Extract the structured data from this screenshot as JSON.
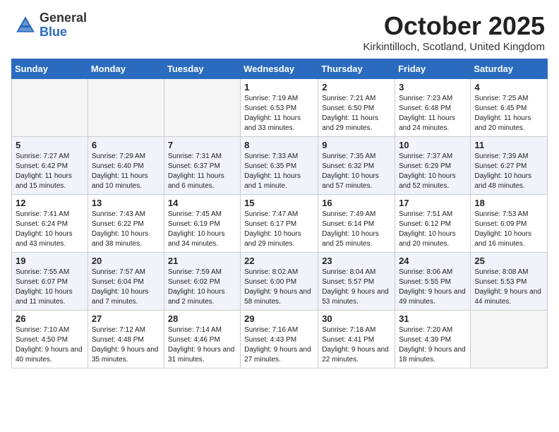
{
  "header": {
    "logo_general": "General",
    "logo_blue": "Blue",
    "month_title": "October 2025",
    "location": "Kirkintilloch, Scotland, United Kingdom"
  },
  "days_of_week": [
    "Sunday",
    "Monday",
    "Tuesday",
    "Wednesday",
    "Thursday",
    "Friday",
    "Saturday"
  ],
  "weeks": [
    [
      {
        "day": "",
        "info": ""
      },
      {
        "day": "",
        "info": ""
      },
      {
        "day": "",
        "info": ""
      },
      {
        "day": "1",
        "info": "Sunrise: 7:19 AM\nSunset: 6:53 PM\nDaylight: 11 hours\nand 33 minutes."
      },
      {
        "day": "2",
        "info": "Sunrise: 7:21 AM\nSunset: 6:50 PM\nDaylight: 11 hours\nand 29 minutes."
      },
      {
        "day": "3",
        "info": "Sunrise: 7:23 AM\nSunset: 6:48 PM\nDaylight: 11 hours\nand 24 minutes."
      },
      {
        "day": "4",
        "info": "Sunrise: 7:25 AM\nSunset: 6:45 PM\nDaylight: 11 hours\nand 20 minutes."
      }
    ],
    [
      {
        "day": "5",
        "info": "Sunrise: 7:27 AM\nSunset: 6:42 PM\nDaylight: 11 hours\nand 15 minutes."
      },
      {
        "day": "6",
        "info": "Sunrise: 7:29 AM\nSunset: 6:40 PM\nDaylight: 11 hours\nand 10 minutes."
      },
      {
        "day": "7",
        "info": "Sunrise: 7:31 AM\nSunset: 6:37 PM\nDaylight: 11 hours\nand 6 minutes."
      },
      {
        "day": "8",
        "info": "Sunrise: 7:33 AM\nSunset: 6:35 PM\nDaylight: 11 hours\nand 1 minute."
      },
      {
        "day": "9",
        "info": "Sunrise: 7:35 AM\nSunset: 6:32 PM\nDaylight: 10 hours\nand 57 minutes."
      },
      {
        "day": "10",
        "info": "Sunrise: 7:37 AM\nSunset: 6:29 PM\nDaylight: 10 hours\nand 52 minutes."
      },
      {
        "day": "11",
        "info": "Sunrise: 7:39 AM\nSunset: 6:27 PM\nDaylight: 10 hours\nand 48 minutes."
      }
    ],
    [
      {
        "day": "12",
        "info": "Sunrise: 7:41 AM\nSunset: 6:24 PM\nDaylight: 10 hours\nand 43 minutes."
      },
      {
        "day": "13",
        "info": "Sunrise: 7:43 AM\nSunset: 6:22 PM\nDaylight: 10 hours\nand 38 minutes."
      },
      {
        "day": "14",
        "info": "Sunrise: 7:45 AM\nSunset: 6:19 PM\nDaylight: 10 hours\nand 34 minutes."
      },
      {
        "day": "15",
        "info": "Sunrise: 7:47 AM\nSunset: 6:17 PM\nDaylight: 10 hours\nand 29 minutes."
      },
      {
        "day": "16",
        "info": "Sunrise: 7:49 AM\nSunset: 6:14 PM\nDaylight: 10 hours\nand 25 minutes."
      },
      {
        "day": "17",
        "info": "Sunrise: 7:51 AM\nSunset: 6:12 PM\nDaylight: 10 hours\nand 20 minutes."
      },
      {
        "day": "18",
        "info": "Sunrise: 7:53 AM\nSunset: 6:09 PM\nDaylight: 10 hours\nand 16 minutes."
      }
    ],
    [
      {
        "day": "19",
        "info": "Sunrise: 7:55 AM\nSunset: 6:07 PM\nDaylight: 10 hours\nand 11 minutes."
      },
      {
        "day": "20",
        "info": "Sunrise: 7:57 AM\nSunset: 6:04 PM\nDaylight: 10 hours\nand 7 minutes."
      },
      {
        "day": "21",
        "info": "Sunrise: 7:59 AM\nSunset: 6:02 PM\nDaylight: 10 hours\nand 2 minutes."
      },
      {
        "day": "22",
        "info": "Sunrise: 8:02 AM\nSunset: 6:00 PM\nDaylight: 9 hours\nand 58 minutes."
      },
      {
        "day": "23",
        "info": "Sunrise: 8:04 AM\nSunset: 5:57 PM\nDaylight: 9 hours\nand 53 minutes."
      },
      {
        "day": "24",
        "info": "Sunrise: 8:06 AM\nSunset: 5:55 PM\nDaylight: 9 hours\nand 49 minutes."
      },
      {
        "day": "25",
        "info": "Sunrise: 8:08 AM\nSunset: 5:53 PM\nDaylight: 9 hours\nand 44 minutes."
      }
    ],
    [
      {
        "day": "26",
        "info": "Sunrise: 7:10 AM\nSunset: 4:50 PM\nDaylight: 9 hours\nand 40 minutes."
      },
      {
        "day": "27",
        "info": "Sunrise: 7:12 AM\nSunset: 4:48 PM\nDaylight: 9 hours\nand 35 minutes."
      },
      {
        "day": "28",
        "info": "Sunrise: 7:14 AM\nSunset: 4:46 PM\nDaylight: 9 hours\nand 31 minutes."
      },
      {
        "day": "29",
        "info": "Sunrise: 7:16 AM\nSunset: 4:43 PM\nDaylight: 9 hours\nand 27 minutes."
      },
      {
        "day": "30",
        "info": "Sunrise: 7:18 AM\nSunset: 4:41 PM\nDaylight: 9 hours\nand 22 minutes."
      },
      {
        "day": "31",
        "info": "Sunrise: 7:20 AM\nSunset: 4:39 PM\nDaylight: 9 hours\nand 18 minutes."
      },
      {
        "day": "",
        "info": ""
      }
    ]
  ]
}
